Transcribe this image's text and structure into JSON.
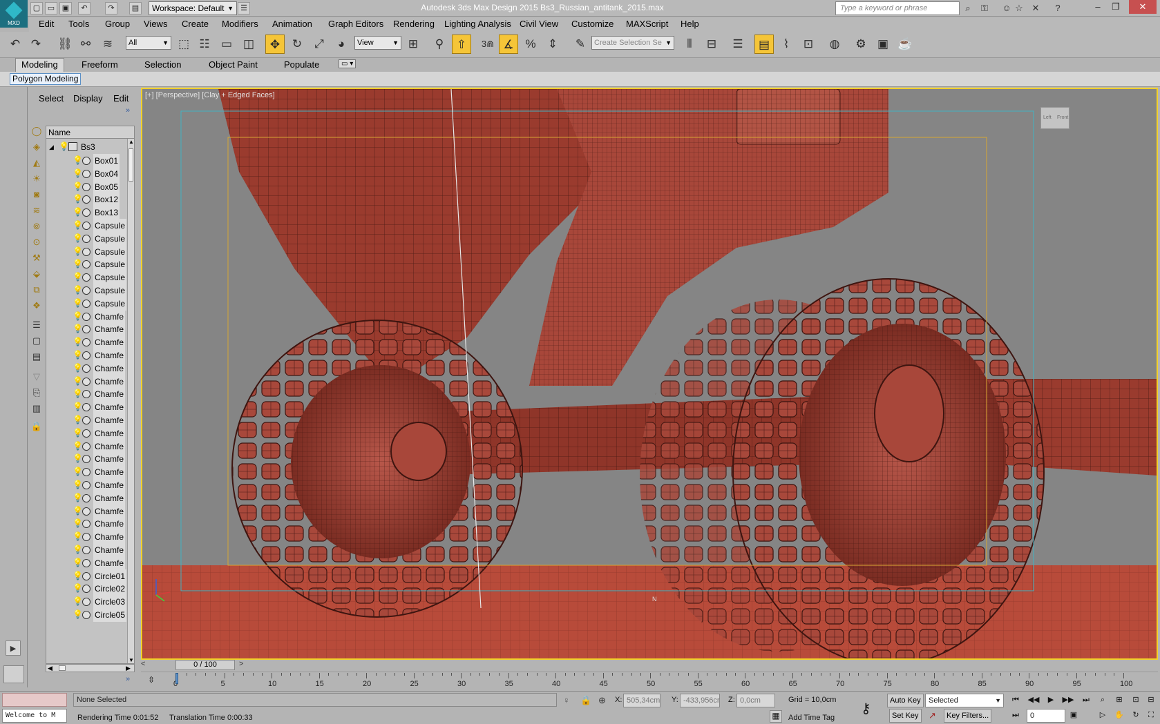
{
  "app": {
    "logo_text": "MXD",
    "title": "Autodesk 3ds Max Design 2015     Bs3_Russian_antitank_2015.max",
    "workspace": "Workspace: Default",
    "search_placeholder": "Type a keyword or phrase"
  },
  "menu": [
    "Edit",
    "Tools",
    "Group",
    "Views",
    "Create",
    "Modifiers",
    "Animation",
    "Graph Editors",
    "Rendering",
    "Lighting Analysis",
    "Civil View",
    "Customize",
    "MAXScript",
    "Help"
  ],
  "toolbar": {
    "selection_filter": "All",
    "ref_coord": "View",
    "snap_label": "3",
    "named_selection_placeholder": "Create Selection Se"
  },
  "ribbon": {
    "tabs": [
      "Modeling",
      "Freeform",
      "Selection",
      "Object Paint",
      "Populate"
    ],
    "active_tab": "Modeling",
    "panel": "Polygon Modeling"
  },
  "explorer": {
    "menus": [
      "Select",
      "Display",
      "Edit"
    ],
    "column_header": "Name",
    "root": "Bs3",
    "items": [
      "Box01",
      "Box04",
      "Box05",
      "Box12",
      "Box13",
      "Capsule",
      "Capsule",
      "Capsule",
      "Capsule",
      "Capsule",
      "Capsule",
      "Capsule",
      "Chamfe",
      "Chamfe",
      "Chamfe",
      "Chamfe",
      "Chamfe",
      "Chamfe",
      "Chamfe",
      "Chamfe",
      "Chamfe",
      "Chamfe",
      "Chamfe",
      "Chamfe",
      "Chamfe",
      "Chamfe",
      "Chamfe",
      "Chamfe",
      "Chamfe",
      "Chamfe",
      "Chamfe",
      "Chamfe",
      "Circle01",
      "Circle02",
      "Circle03",
      "Circle05"
    ]
  },
  "viewport": {
    "label": "[+] [Perspective] [Clay + Edged Faces]",
    "viewcube_left": "Left",
    "viewcube_front": "Front",
    "gizmo_label": "N",
    "colors": {
      "border": "#f2d12a",
      "background": "#858585",
      "model": "#9a3b2e",
      "model_light": "#b8574a",
      "wire": "#4a1a14",
      "safe_frame_outer": "#41b3c2",
      "safe_frame_inner": "#d8a634"
    }
  },
  "timeline": {
    "position": "0 / 100",
    "frame_fraction": 0.0,
    "ticks": [
      "0",
      "5",
      "10",
      "15",
      "20",
      "25",
      "30",
      "35",
      "40",
      "45",
      "50",
      "55",
      "60",
      "65",
      "70",
      "75",
      "80",
      "85",
      "90",
      "95",
      "100"
    ]
  },
  "status": {
    "listener": "Welcome to M",
    "selection": "None Selected",
    "rendering_time": "Rendering Time  0:01:52",
    "translation_time": "Translation Time  0:00:33",
    "x_label": "X:",
    "x_value": "505,34cm",
    "y_label": "Y:",
    "y_value": "-433,956cr",
    "z_label": "Z:",
    "z_value": "0,0cm",
    "grid": "Grid = 10,0cm",
    "add_time_tag": "Add Time Tag",
    "auto_key": "Auto Key",
    "set_key": "Set Key",
    "key_mode": "Selected",
    "key_filters": "Key Filters...",
    "current_frame": "0"
  }
}
